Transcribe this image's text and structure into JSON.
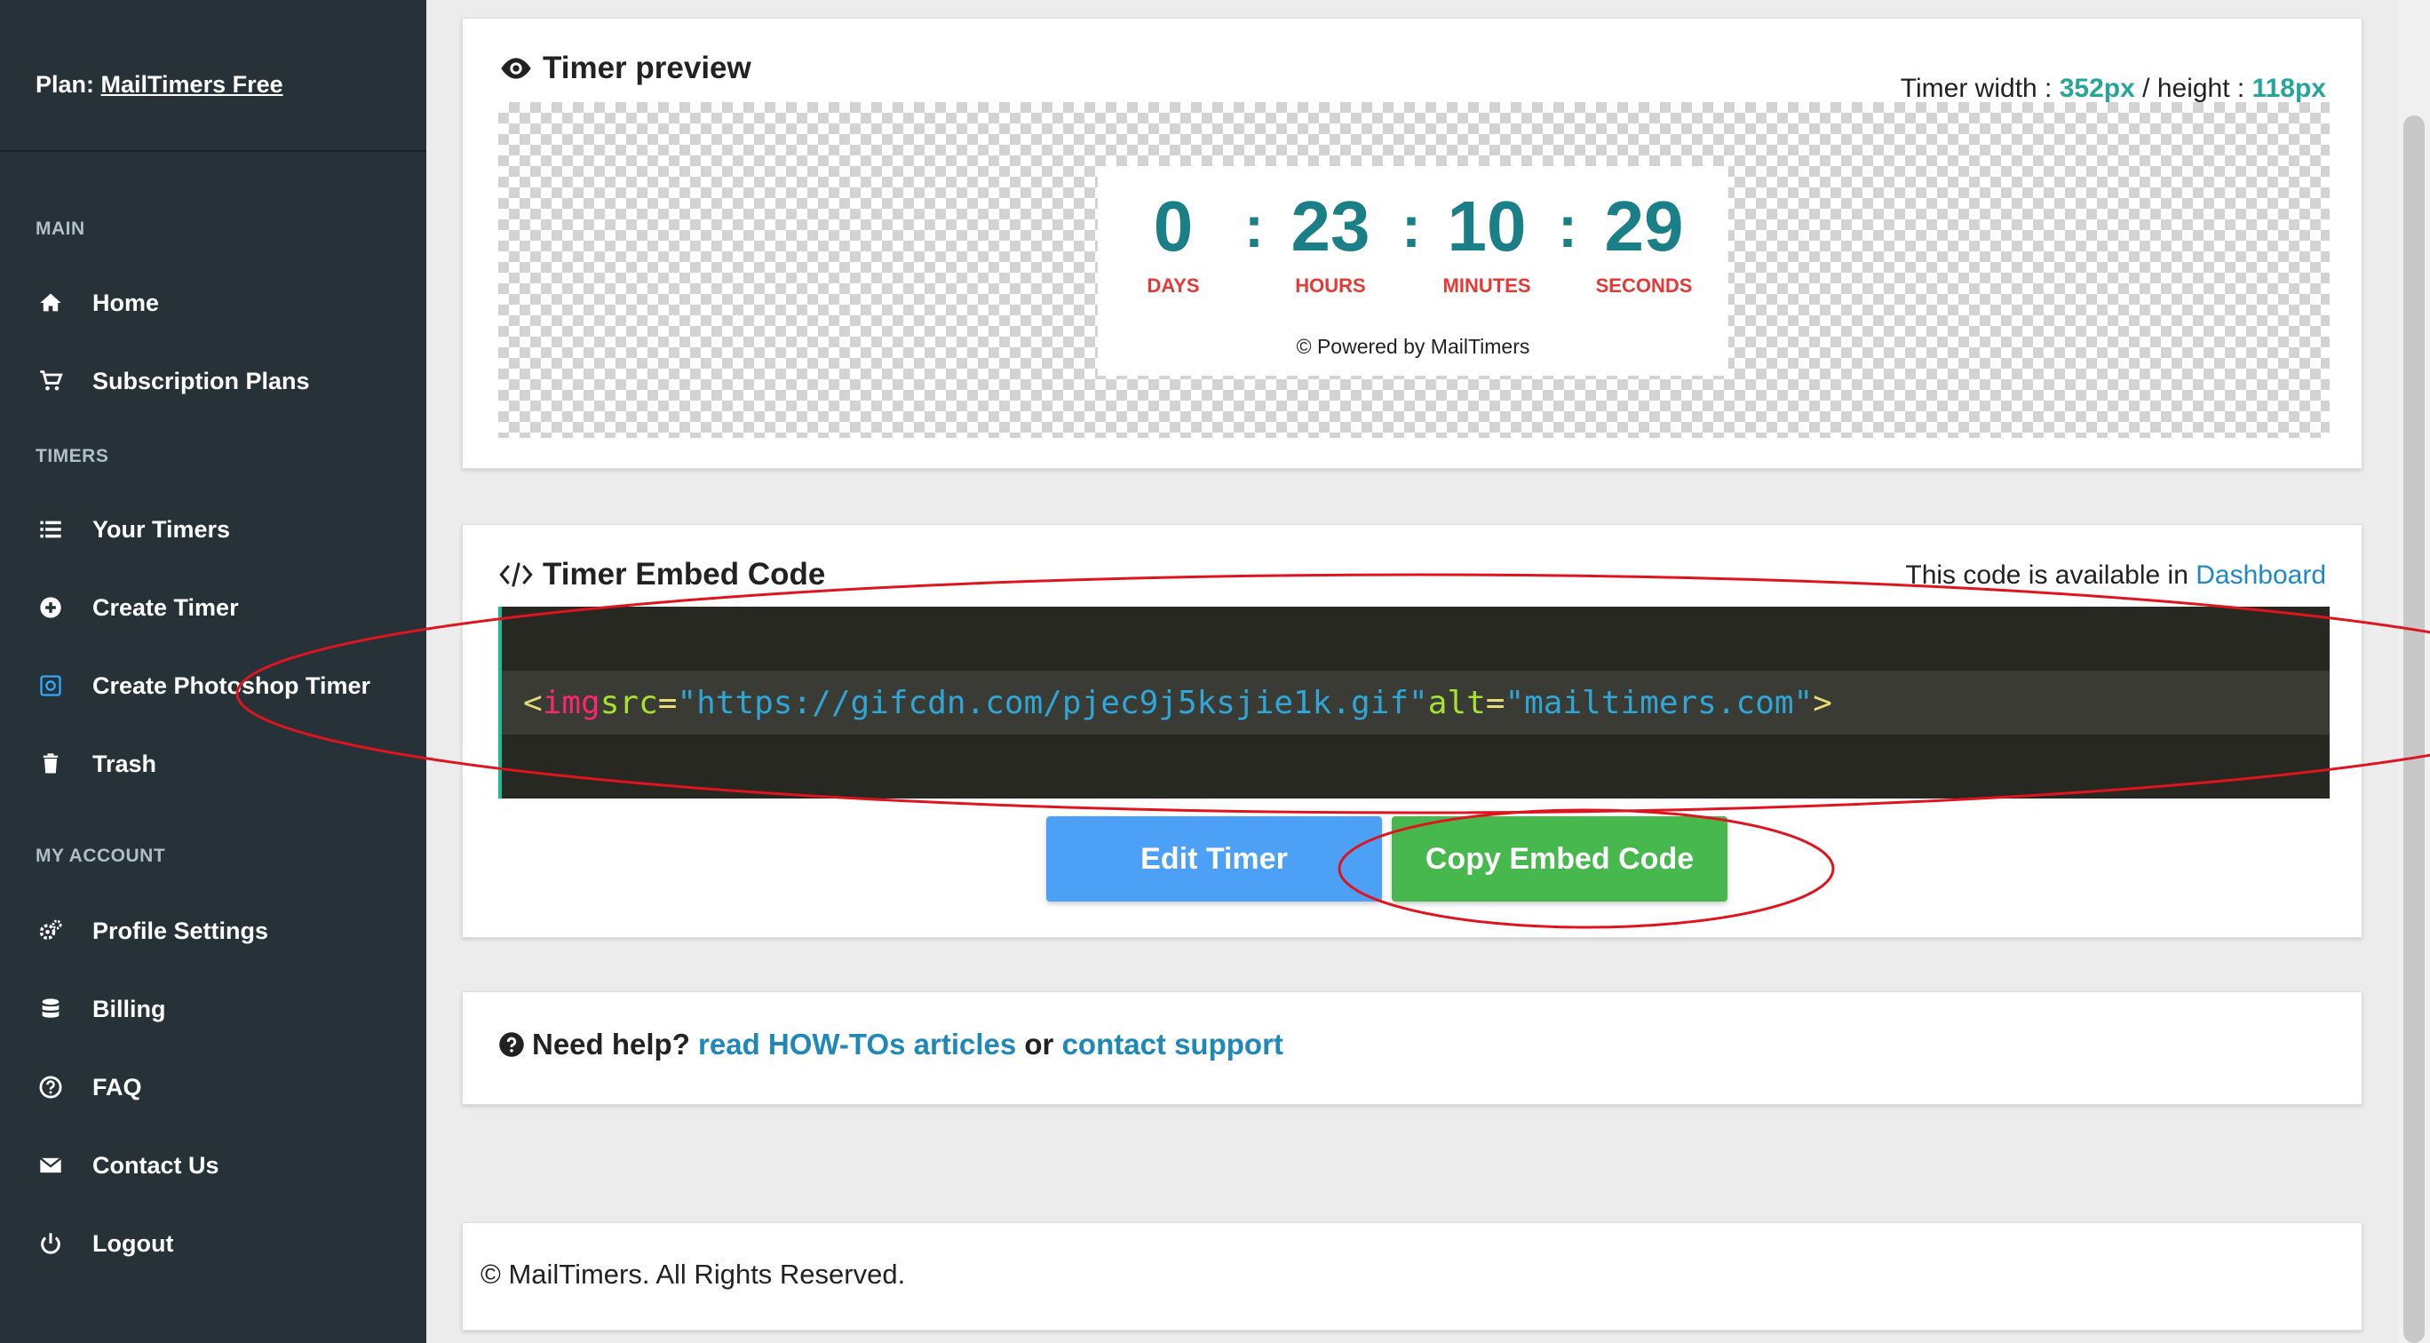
{
  "sidebar": {
    "plan_prefix": "Plan:",
    "plan_name": "MailTimers Free",
    "sections": {
      "main": "MAIN",
      "timers": "TIMERS",
      "account": "MY ACCOUNT"
    },
    "items": [
      {
        "label": "Home",
        "icon": "home-icon"
      },
      {
        "label": "Subscription Plans",
        "icon": "cart-icon"
      },
      {
        "label": "Your Timers",
        "icon": "list-icon"
      },
      {
        "label": "Create Timer",
        "icon": "plus-circle-icon"
      },
      {
        "label": "Create Photoshop Timer",
        "icon": "photoshop-icon"
      },
      {
        "label": "Trash",
        "icon": "trash-icon"
      },
      {
        "label": "Profile Settings",
        "icon": "gears-icon"
      },
      {
        "label": "Billing",
        "icon": "database-icon"
      },
      {
        "label": "FAQ",
        "icon": "question-circle-icon"
      },
      {
        "label": "Contact Us",
        "icon": "envelope-icon"
      },
      {
        "label": "Logout",
        "icon": "power-icon"
      }
    ]
  },
  "preview": {
    "title": "Timer preview",
    "width_label": "Timer width :",
    "width_value": "352px",
    "sep": "/ height :",
    "height_value": "118px",
    "timer": {
      "days": "0",
      "days_label": "DAYS",
      "hours": "23",
      "hours_label": "HOURS",
      "minutes": "10",
      "minutes_label": "MINUTES",
      "seconds": "29",
      "seconds_label": "SECONDS",
      "colon": ":",
      "powered": "© Powered by MailTimers"
    }
  },
  "embed": {
    "title": "Timer Embed Code",
    "avail_text": "This code is available in",
    "avail_link": "Dashboard",
    "code": {
      "open": "<",
      "tag": "img",
      "attr1": "src",
      "eq": "=",
      "val1": "\"https://gifcdn.com/pjec9j5ksjie1k.gif\"",
      "attr2": "alt",
      "val2": "\"mailtimers.com\"",
      "close": ">"
    },
    "edit_button": "Edit Timer",
    "copy_button": "Copy Embed Code"
  },
  "help": {
    "prefix": "Need help?",
    "link1": "read HOW-TOs articles",
    "or": "or",
    "link2": "contact support"
  },
  "footer": {
    "text": "© MailTimers. All Rights Reserved."
  },
  "colors": {
    "sidebar_bg": "#263238",
    "accent_teal": "#26a69a",
    "timer_digits": "#1a7f86",
    "timer_labels": "#e53935",
    "edit_button": "#4ca1f7",
    "copy_button": "#46b84e",
    "annotation_red": "#e0141e"
  }
}
